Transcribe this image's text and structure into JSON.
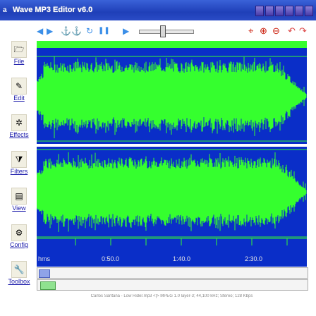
{
  "window": {
    "title": "Wave MP3 Editor v6.0",
    "app_icon": "a"
  },
  "titlebar_buttons": [
    "btn1",
    "btn2",
    "btn3",
    "btn4",
    "btn5",
    "btn6"
  ],
  "toolbar": {
    "left": [
      {
        "name": "rewind-icon",
        "glyph": "◀"
      },
      {
        "name": "forward-icon",
        "glyph": "▶"
      },
      {
        "name": "mark-in-icon",
        "glyph": "⚓"
      },
      {
        "name": "mark-out-icon",
        "glyph": "⚓"
      },
      {
        "name": "loop-icon",
        "glyph": "↻"
      },
      {
        "name": "pause-icon",
        "glyph": "❚❚"
      },
      {
        "name": "play-icon",
        "glyph": "▶"
      }
    ],
    "right": [
      {
        "name": "zoom-fit-icon",
        "glyph": "⌖"
      },
      {
        "name": "zoom-in-icon",
        "glyph": "⊕"
      },
      {
        "name": "zoom-out-icon",
        "glyph": "⊖"
      },
      {
        "name": "undo-icon",
        "glyph": "↶"
      },
      {
        "name": "redo-icon",
        "glyph": "↷"
      }
    ]
  },
  "sidebar": {
    "items": [
      {
        "label": "File",
        "icon": "file-icon",
        "glyph": "🗁"
      },
      {
        "label": "Edit",
        "icon": "edit-icon",
        "glyph": "✎"
      },
      {
        "label": "Effects",
        "icon": "effects-icon",
        "glyph": "✲"
      },
      {
        "label": "Filters",
        "icon": "filters-icon",
        "glyph": "⧩"
      },
      {
        "label": "View",
        "icon": "view-icon",
        "glyph": "▤"
      },
      {
        "label": "Config",
        "icon": "config-icon",
        "glyph": "⚙"
      },
      {
        "label": "Toolbox",
        "icon": "toolbox-icon",
        "glyph": "🔧"
      }
    ]
  },
  "timeline": {
    "labels": [
      "hms",
      "0:50.0",
      "1:40.0",
      "2:30.0"
    ]
  },
  "status": "Carlos Santana - Low Rider.mp3   <|>  MPEG 1.0 layer-3; 44,100 kHz; Stereo; 128 Kbps",
  "colors": {
    "wave_bg": "#0a2ec8",
    "wave": "#35ff2e",
    "titlebar": "#2546c0"
  }
}
